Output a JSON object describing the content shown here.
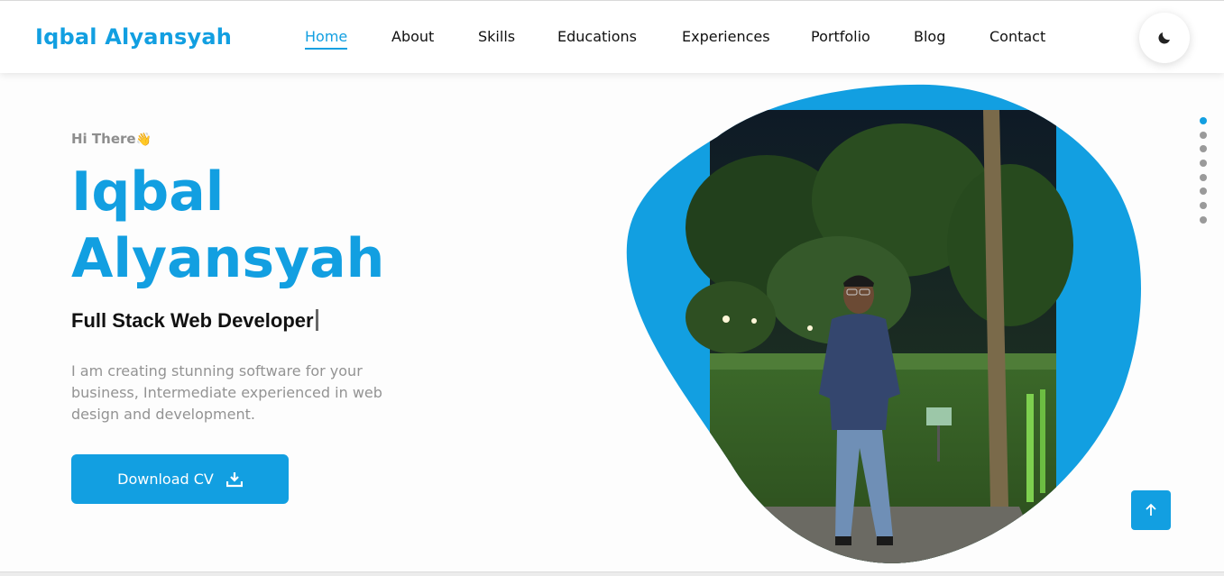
{
  "header": {
    "brand": "Iqbal Alyansyah",
    "nav": [
      {
        "label": "Home",
        "active": true
      },
      {
        "label": "About"
      },
      {
        "label": "Skills"
      },
      {
        "label": "Educations"
      },
      {
        "label": "Experiences"
      },
      {
        "label": "Portfolio"
      },
      {
        "label": "Blog"
      },
      {
        "label": "Contact"
      }
    ],
    "theme_icon": "moon-icon"
  },
  "hero": {
    "greeting": "Hi There",
    "greeting_emoji": "👋",
    "name_line1": "Iqbal",
    "name_line2": "Alyansyah",
    "role": "Full Stack Web Developer",
    "description": "I am creating stunning software for your business, Intermediate experienced in web design and development.",
    "cta_label": "Download CV",
    "cta_icon": "download-icon"
  },
  "section_dots": {
    "count": 8,
    "active_index": 0
  },
  "scroll_top_icon": "arrow-up-icon",
  "colors": {
    "accent": "#129fe1",
    "text": "#111111",
    "muted": "#939393"
  }
}
